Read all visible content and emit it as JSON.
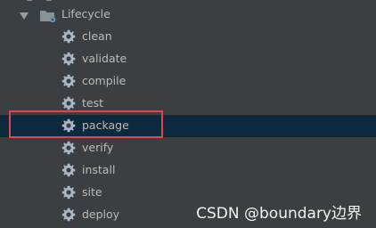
{
  "tree": {
    "root": {
      "label": "Lifecycle",
      "expanded": true,
      "icon": "folder-gear-icon"
    },
    "items": [
      {
        "label": "clean",
        "icon": "gear-icon"
      },
      {
        "label": "validate",
        "icon": "gear-icon"
      },
      {
        "label": "compile",
        "icon": "gear-icon"
      },
      {
        "label": "test",
        "icon": "gear-icon"
      },
      {
        "label": "package",
        "icon": "gear-icon",
        "selected": true
      },
      {
        "label": "verify",
        "icon": "gear-icon"
      },
      {
        "label": "install",
        "icon": "gear-icon"
      },
      {
        "label": "site",
        "icon": "gear-icon"
      },
      {
        "label": "deploy",
        "icon": "gear-icon"
      }
    ]
  },
  "watermark": "CSDN @boundary边界",
  "colors": {
    "background": "#3c3f41",
    "selected_row": "#0d293e",
    "highlight_border": "#e2434d",
    "text": "#bbbbbb"
  }
}
